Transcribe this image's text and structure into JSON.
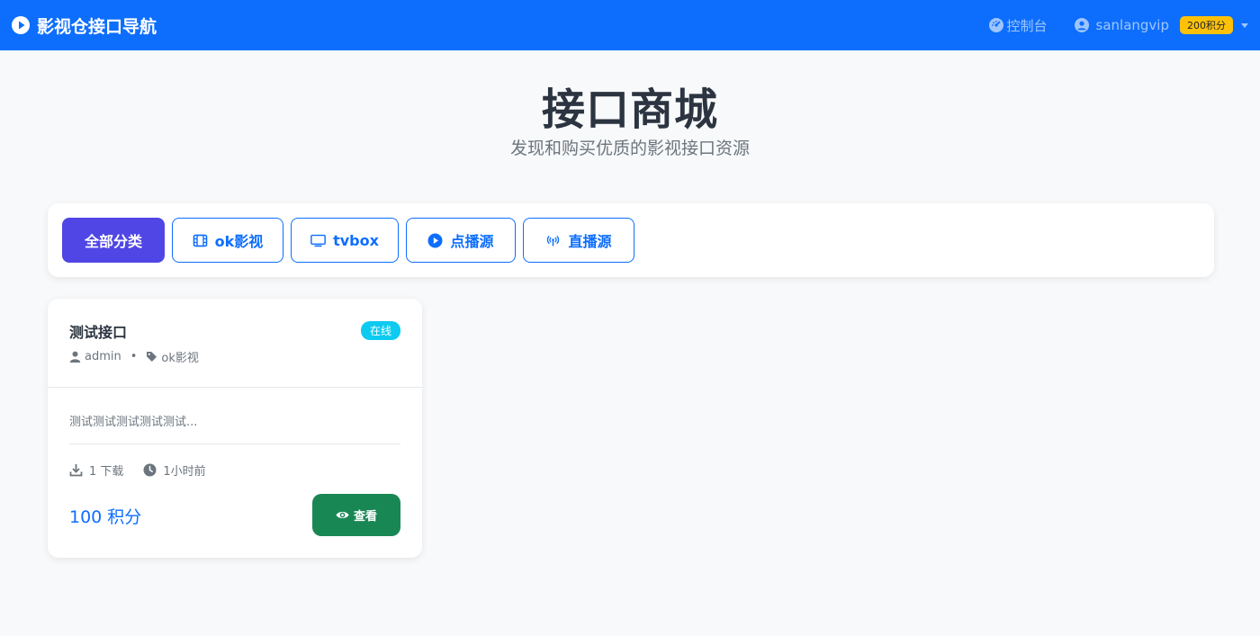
{
  "navbar": {
    "brand": "影视仓接口导航",
    "brand_icon": "play-circle-icon",
    "console_label": "控制台",
    "console_icon": "gauge-icon",
    "user_name": "sanlangvip",
    "user_icon": "user-circle-icon",
    "points_badge": "200积分",
    "bg_color": "#0d6efd"
  },
  "hero": {
    "title": "接口商城",
    "subtitle": "发现和购买优质的影视接口资源"
  },
  "categories": [
    {
      "label": "全部分类",
      "icon": "",
      "active": true
    },
    {
      "label": "ok影视",
      "icon": "film-icon",
      "active": false
    },
    {
      "label": "tvbox",
      "icon": "tv-icon",
      "active": false
    },
    {
      "label": "点播源",
      "icon": "play-circle-icon",
      "active": false
    },
    {
      "label": "直播源",
      "icon": "broadcast-icon",
      "active": false
    }
  ],
  "items": [
    {
      "title": "测试接口",
      "status": "在线",
      "author": "admin",
      "category": "ok影视",
      "description": "测试测试测试测试测试...",
      "downloads": "1 下载",
      "time": "1小时前",
      "price": "100 积分",
      "view_label": "查看"
    }
  ],
  "colors": {
    "primary": "#0d6efd",
    "active_category": "#4f46e5",
    "success": "#198754",
    "info": "#0dcaf0",
    "warning": "#ffc107"
  }
}
